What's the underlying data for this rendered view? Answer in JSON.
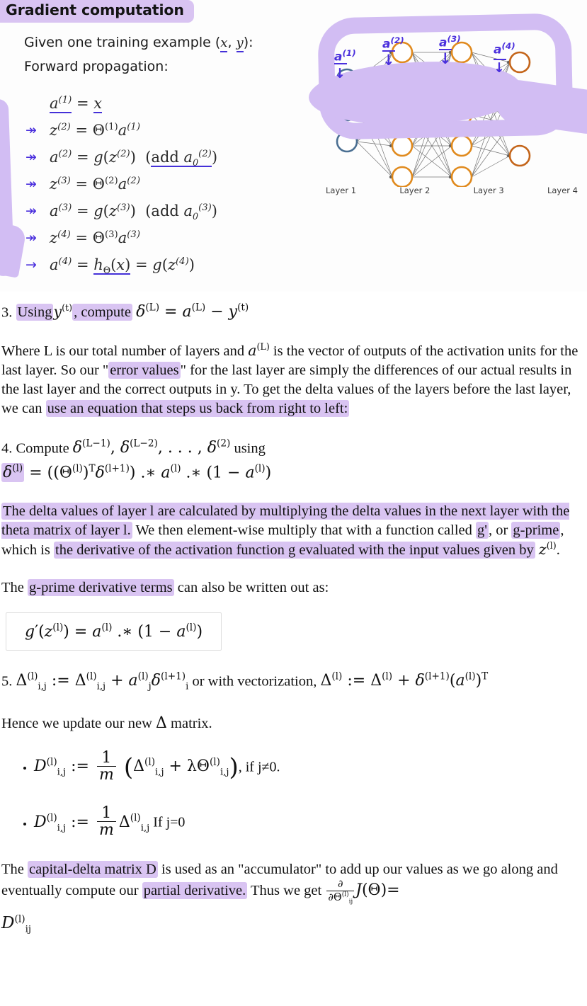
{
  "slide": {
    "title": "Gradient computation",
    "subtitle_prefix": "Given one training example (",
    "subtitle_x": "x",
    "subtitle_comma": ", ",
    "subtitle_y": "y",
    "subtitle_suffix": "):",
    "forward_label": "Forward propagation:",
    "equations": [
      {
        "arrow": "",
        "text": "a(1) = x"
      },
      {
        "arrow": "↠",
        "text": "z(2) = Θ(1)a(1)"
      },
      {
        "arrow": "↠",
        "text": "a(2) = g(z(2))  (add a0(2))"
      },
      {
        "arrow": "↠",
        "text": "z(3) = Θ(2)a(2)"
      },
      {
        "arrow": "↠",
        "text": "a(3) = g(z(3))  (add a0(3))"
      },
      {
        "arrow": "↠",
        "text": "z(4) = Θ(3)a(3)"
      },
      {
        "arrow": "→",
        "text": "a(4) = hΘ(x) = g(z(4))"
      }
    ],
    "network": {
      "layer_labels": [
        "Layer 1",
        "Layer 2",
        "Layer 3",
        "Layer 4"
      ],
      "layer_node_counts": [
        3,
        5,
        5,
        4
      ],
      "input_node_color": "#4a6f92",
      "hidden_node_color": "#e08a1e",
      "output_node_color": "#c4651a",
      "edge_color": "#555555",
      "annotations": [
        "a(1)",
        "a(2)",
        "a(3)",
        "a(4)"
      ]
    },
    "marker_color": "#d2bdf3",
    "annotation_ink_color": "#4a2fdd"
  },
  "highlight_color": "#d9c4f2",
  "body": {
    "step3": {
      "number": "3.",
      "hl_using": "Using",
      "math_y": "y(t)",
      "hl_compute": ", compute",
      "equation": "δ(L) = a(L) − y(t)"
    },
    "para1": {
      "seg1": "Where L is our total number of layers and ",
      "math1": "a(L)",
      "seg2": " is the vector of outputs of the activation units for the last layer. So our \"",
      "hl1": "error values",
      "seg3": "\" for the last layer are simply the differences of our actual results in the last layer and the correct outputs in y. To get the delta values of the layers before the last layer, we can ",
      "hl2": "use an equation that steps us back from right to left:"
    },
    "step4": {
      "number": "4.",
      "text_before": " Compute ",
      "math_deltas": "δ(L−1), δ(L−2), … , δ(2)",
      "text_after": " using",
      "equation_hl": "δ(l)",
      "equation_rest": "= ((Θ(l))T δ(l+1)) .∗ a(l) .∗ (1 − a(l))"
    },
    "para2": {
      "hl1": "The delta values of layer l are calculated by multiplying the delta values in the next layer with the theta matrix of layer l.",
      "seg1": " We then element-wise multiply that with a function called ",
      "hl2": "g'",
      "seg2": ", or ",
      "hl3": "g-prime",
      "seg3": ", which is ",
      "hl4": "the derivative of the activation function g evaluated with the input values given by",
      "math1": "z(l)",
      "seg4": "."
    },
    "para3": {
      "seg1": "The ",
      "hl1": "g-prime derivative terms",
      "seg2": " can also be written out as:"
    },
    "boxed_equation": "g′(z(l)) = a(l) .∗ (1 − a(l))",
    "step5": {
      "number": "5.",
      "eq1": "Δ(l)i,j := Δ(l)i,j + a(l)j δ(l+1)i",
      "mid": " or with vectorization, ",
      "eq2": "Δ(l) := Δ(l) + δ(l+1)(a(l))T"
    },
    "hence": {
      "seg1": "Hence we update our new ",
      "delta": "Δ",
      "seg2": " matrix."
    },
    "dlist": [
      {
        "lhs": "D(l)i,j :=",
        "frac_num": "1",
        "frac_den": "m",
        "body": "(Δ(l)i,j + λΘ(l)i,j)",
        "cond": ", if j≠0."
      },
      {
        "lhs": "D(l)i,j :=",
        "frac_num": "1",
        "frac_den": "m",
        "body": "Δ(l)i,j",
        "cond": " If j=0"
      }
    ],
    "para4": {
      "seg1": "The ",
      "hl1": "capital-delta matrix D",
      "seg2": " is used as an \"accumulator\" to add up our values as we go along and eventually compute our ",
      "hl2": "partial derivative.",
      "seg3": " Thus we get ",
      "frac_num": "∂",
      "frac_den": "∂Θ(l)ij",
      "tail": "J(Θ)=",
      "final": "D(l)ij"
    }
  }
}
